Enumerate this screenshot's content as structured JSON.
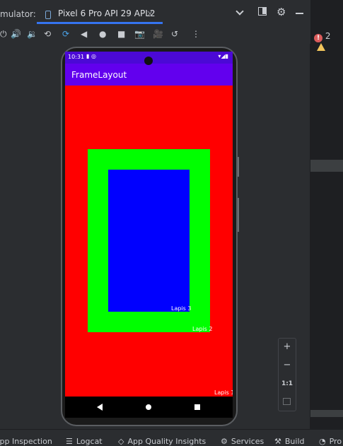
{
  "tabbar": {
    "left_label": "mulator:",
    "tab_title": "Pixel 6 Pro API 29 APL2",
    "close_glyph": "×",
    "icons": [
      "chevron-down-icon",
      "dock-icon",
      "gear-icon",
      "minimize-icon"
    ]
  },
  "toolbar": {
    "icons": [
      "power-icon",
      "volume-up-icon",
      "volume-down-icon",
      "rotate-left-icon",
      "rotate-right-icon",
      "back-icon",
      "home-icon",
      "overview-icon",
      "camera-icon",
      "record-icon",
      "replay-icon",
      "more-icon"
    ]
  },
  "problems": {
    "errors": "2"
  },
  "phone": {
    "status_time": "10:31",
    "app_title": "FrameLayout",
    "labels": {
      "layer1": "Lapis 1",
      "layer2": "Lapis 2",
      "layer3": "Lapis 3"
    },
    "colors": {
      "layer1": "#ff0000",
      "layer2": "#00ff00",
      "layer3": "#0000ff",
      "appbar": "#6200ee",
      "statusbar": "#4b09d6"
    }
  },
  "zoom": {
    "plus": "+",
    "minus": "−",
    "one_to_one": "1:1"
  },
  "bottombar": {
    "items": [
      {
        "label": "App Inspection"
      },
      {
        "label": "Logcat"
      },
      {
        "label": "App Quality Insights"
      },
      {
        "label": "Services"
      },
      {
        "label": "Build"
      },
      {
        "label": "Pro"
      }
    ]
  }
}
